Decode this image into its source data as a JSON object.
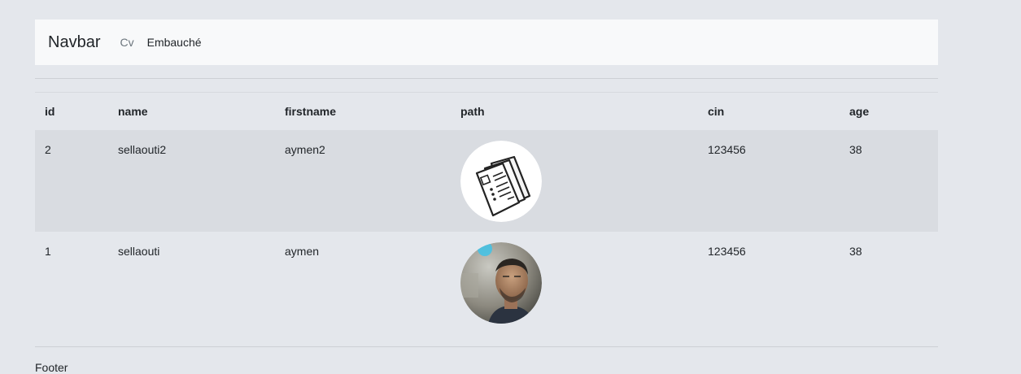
{
  "navbar": {
    "brand": "Navbar",
    "links": [
      "Cv",
      "Embauché"
    ]
  },
  "table": {
    "columns": [
      "id",
      "name",
      "firstname",
      "path",
      "cin",
      "age"
    ],
    "rows": [
      {
        "id": "2",
        "name": "sellaouti2",
        "firstname": "aymen2",
        "path_image": "cv-document-icon",
        "cin": "123456",
        "age": "38"
      },
      {
        "id": "1",
        "name": "sellaouti",
        "firstname": "aymen",
        "path_image": "profile-photo",
        "cin": "123456",
        "age": "38"
      }
    ]
  },
  "footer": {
    "text": "Footer"
  }
}
